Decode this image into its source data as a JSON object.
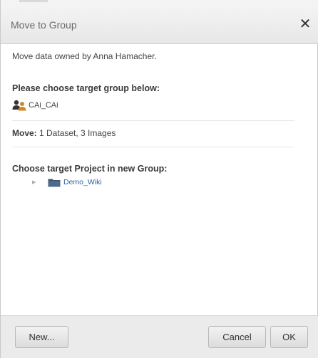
{
  "dialog": {
    "title": "Move to Group",
    "close_symbol": "✕"
  },
  "content": {
    "owner_text": "Move data owned by Anna Hamacher.",
    "choose_group_heading": "Please choose target group below:",
    "group": {
      "icon": "group-users-icon",
      "label": "CAi_CAi"
    },
    "move": {
      "label": "Move:",
      "value": " 1 Dataset, 3 Images"
    },
    "choose_project_heading": "Choose target Project in new Group:",
    "tree": [
      {
        "expander_symbol": "▶",
        "icon": "folder-icon",
        "label": "Demo_Wiki"
      }
    ]
  },
  "footer": {
    "new_label": "New...",
    "cancel_label": "Cancel",
    "ok_label": "OK"
  },
  "colors": {
    "link": "#2a5fa8",
    "folder": "#3e5673",
    "titlebar": "#eeeeee",
    "footer": "#ebebeb"
  }
}
